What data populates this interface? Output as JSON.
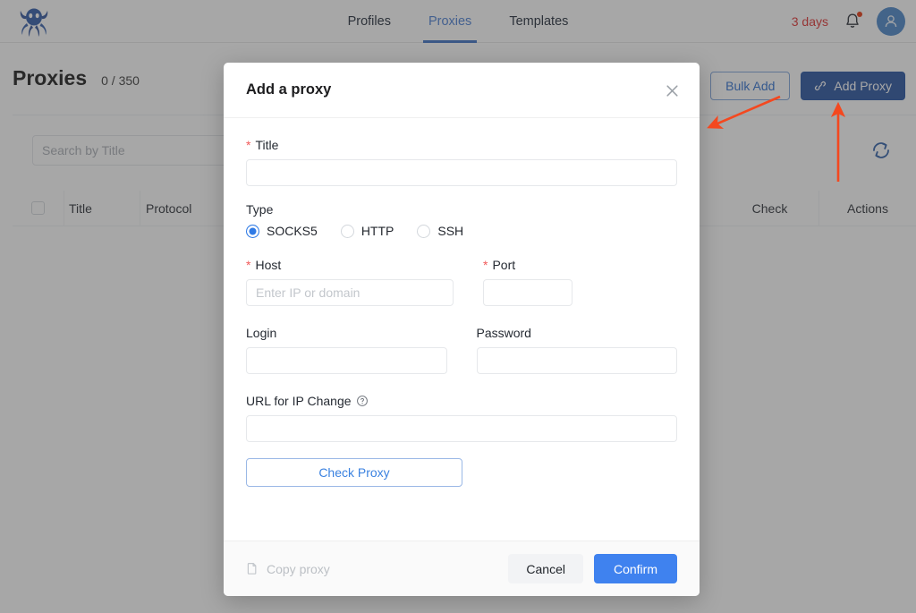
{
  "app": {
    "logo_icon": "octopus-logo-icon"
  },
  "nav": {
    "items": [
      {
        "label": "Profiles",
        "active": false
      },
      {
        "label": "Proxies",
        "active": true
      },
      {
        "label": "Templates",
        "active": false
      }
    ],
    "trial_label": "3 days",
    "bell_icon": "bell-icon",
    "avatar_icon": "user-avatar-icon"
  },
  "page": {
    "title": "Proxies",
    "count": "0 / 350",
    "bulk_add_label": "Bulk Add",
    "add_proxy_label": "Add Proxy",
    "add_proxy_icon": "link-icon",
    "refresh_icon": "refresh-icon",
    "search_placeholder": "Search by Title",
    "search_value": "",
    "columns": [
      "Title",
      "Protocol",
      "Check",
      "Actions"
    ]
  },
  "modal": {
    "title": "Add a proxy",
    "close_icon": "close-icon",
    "fields": {
      "title": {
        "label": "Title",
        "required": true,
        "value": "",
        "placeholder": ""
      },
      "type": {
        "label": "Type",
        "options": [
          "SOCKS5",
          "HTTP",
          "SSH"
        ],
        "selected": "SOCKS5"
      },
      "host": {
        "label": "Host",
        "required": true,
        "value": "",
        "placeholder": "Enter IP or domain"
      },
      "port": {
        "label": "Port",
        "required": true,
        "value": "",
        "placeholder": ""
      },
      "login": {
        "label": "Login",
        "required": false,
        "value": "",
        "placeholder": ""
      },
      "password": {
        "label": "Password",
        "required": false,
        "value": "",
        "placeholder": ""
      },
      "url_ip_change": {
        "label": "URL for IP Change",
        "required": false,
        "value": "",
        "placeholder": "",
        "help_icon": "help-circle-icon"
      }
    },
    "check_proxy_label": "Check Proxy",
    "footer": {
      "copy_proxy_label": "Copy proxy",
      "copy_icon": "copy-icon",
      "cancel_label": "Cancel",
      "confirm_label": "Confirm"
    }
  },
  "colors": {
    "accent_blue": "#3f82ef",
    "nav_active": "#4a7fd4",
    "add_proxy_bg": "#27529f",
    "trial_red": "#e03131",
    "annotation_red": "#f4481f",
    "required_red": "#f15b5b"
  },
  "annotations": {
    "arrow_to_bulk_add": "arrow-pointing-left-down",
    "arrow_to_add_proxy": "arrow-pointing-up"
  }
}
